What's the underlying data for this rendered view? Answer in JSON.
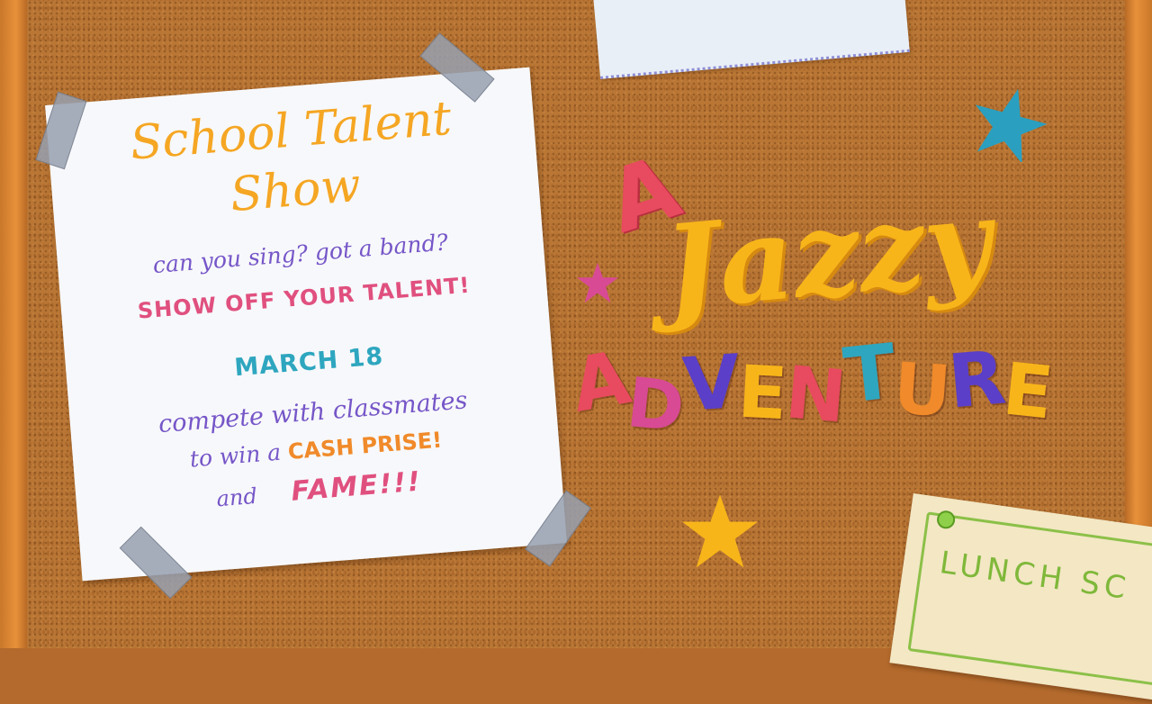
{
  "flyer": {
    "title_line1": "School Talent",
    "title_line2": "Show",
    "question": "can you sing? got a band?",
    "call_to_action": "SHOW OFF YOUR TALENT!",
    "date": "MARCH 18",
    "compete": "compete with classmates",
    "win_prefix": "to win a",
    "cash_prize": "CASH PRISE!",
    "and_word": "and",
    "fame": "FAME!!!"
  },
  "game_title": {
    "article": "A",
    "word1": "Jazzy",
    "word2_letters": [
      {
        "ch": "A",
        "color": "#e84a5f"
      },
      {
        "ch": "D",
        "color": "#d84a94"
      },
      {
        "ch": "V",
        "color": "#5b3fc8"
      },
      {
        "ch": "E",
        "color": "#f8b51a"
      },
      {
        "ch": "N",
        "color": "#e84a5f"
      },
      {
        "ch": "T",
        "color": "#2ea6bf"
      },
      {
        "ch": "U",
        "color": "#f08a2a"
      },
      {
        "ch": "R",
        "color": "#5b3fc8"
      },
      {
        "ch": "E",
        "color": "#f8b51a"
      }
    ]
  },
  "lunch_card": {
    "text": "LUNCH SC"
  },
  "colors": {
    "cork": "#b97634",
    "frame": "#e8913a",
    "star_teal": "#2a9fc0",
    "star_pink": "#d84a94",
    "star_yellow": "#f8b51a"
  }
}
